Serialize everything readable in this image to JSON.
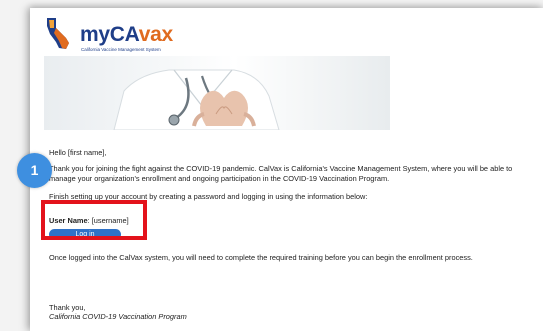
{
  "logo": {
    "brand_prefix": "my",
    "brand_ca": "CA",
    "brand_vax": "vax",
    "tagline": "California Vaccine Management System"
  },
  "email": {
    "greeting": "Hello  [first name],",
    "para1": "Thank you for joining the fight against the COVID-19 pandemic. CalVax is California's Vaccine Management System, where you will be able to manage your organization's enrollment and ongoing participation in the COVID-19 Vaccination Program.",
    "para2": "Finish setting up your account by creating a password and logging in using the information below:",
    "username_label": "User Name",
    "username_value": ": [username]",
    "login_button": "Log in",
    "para3": "Once logged into the CalVax system, you will need to complete the required training before you can begin the enrollment process.",
    "thanks": "Thank you,",
    "signature": "California COVID-19 Vaccination Program"
  },
  "annotation": {
    "step_number": "1"
  },
  "colors": {
    "brand_blue": "#1f3e88",
    "brand_orange": "#e06b1f",
    "button_blue": "#2f72c7",
    "highlight_red": "#e3121b",
    "badge_blue": "#3e8fe0"
  }
}
